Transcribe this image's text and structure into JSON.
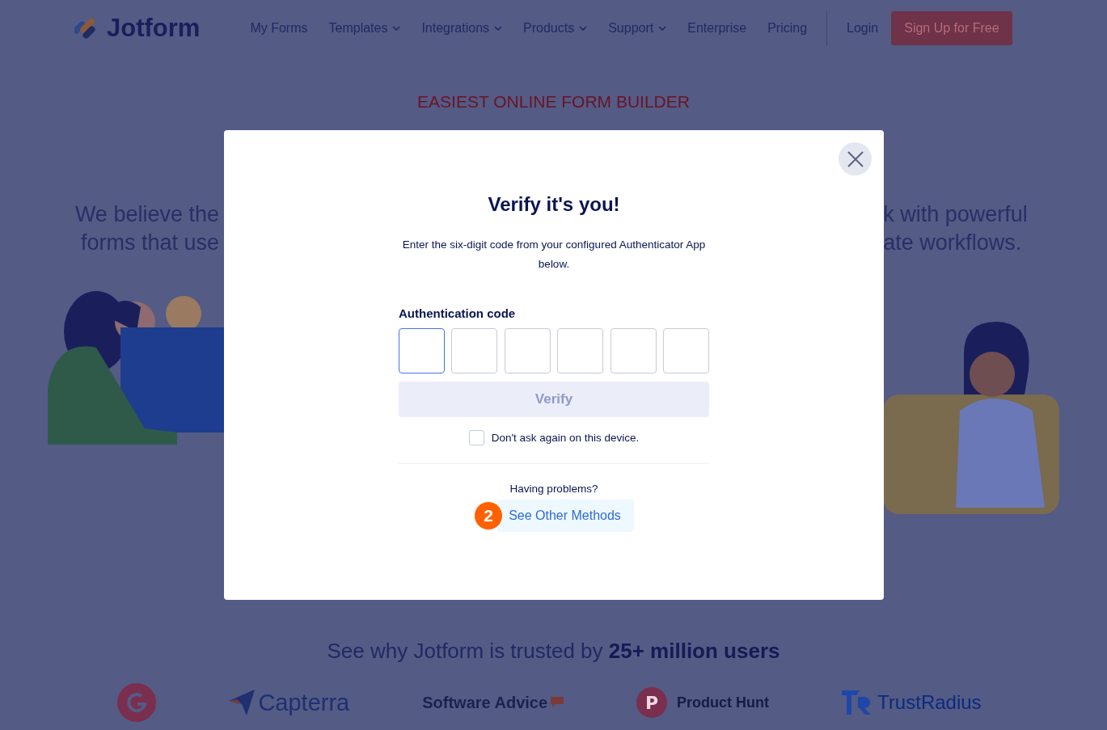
{
  "header": {
    "logo": "Jotform",
    "nav": [
      {
        "label": "My Forms",
        "kind": "link"
      },
      {
        "label": "Templates",
        "kind": "menu"
      },
      {
        "label": "Integrations",
        "kind": "menu"
      },
      {
        "label": "Products",
        "kind": "menu"
      },
      {
        "label": "Support",
        "kind": "menu"
      },
      {
        "label": "Enterprise",
        "kind": "link"
      },
      {
        "label": "Pricing",
        "kind": "link"
      }
    ],
    "login": "Login",
    "signup": "Sign Up for Free"
  },
  "tagline": "EASIEST ONLINE FORM BUILDER",
  "hero": {
    "left_lines": [
      "We believe the",
      "forms that use"
    ],
    "right_lines": [
      "k with powerful",
      "ate workflows."
    ]
  },
  "trust": {
    "text": "See why Jotform is trusted by **25+ million users**",
    "logos": [
      {
        "kind": "g2"
      },
      {
        "kind": "capterra",
        "name": "Capterra"
      },
      {
        "kind": "softwareadvice",
        "name": "Software Advice"
      },
      {
        "kind": "producthunt",
        "badge": "P",
        "name": "Product Hunt"
      },
      {
        "kind": "trustradius",
        "name": "TrustRadius"
      }
    ]
  },
  "modal": {
    "title": "Verify it's you!",
    "description": "Enter the six-digit code from your configured Authenticator App below.",
    "code_label": "Authentication code",
    "code_boxes": [
      {
        "focused": true
      },
      {
        "focused": false
      },
      {
        "focused": false
      },
      {
        "focused": false
      },
      {
        "focused": false
      },
      {
        "focused": false
      }
    ],
    "verify": {
      "label": "Verify",
      "disabled": true
    },
    "remember": {
      "label": "Don't ask again on this device.",
      "checked": false
    },
    "problems": "Having problems?",
    "step_badge": "2",
    "other_methods": "See Other Methods"
  }
}
